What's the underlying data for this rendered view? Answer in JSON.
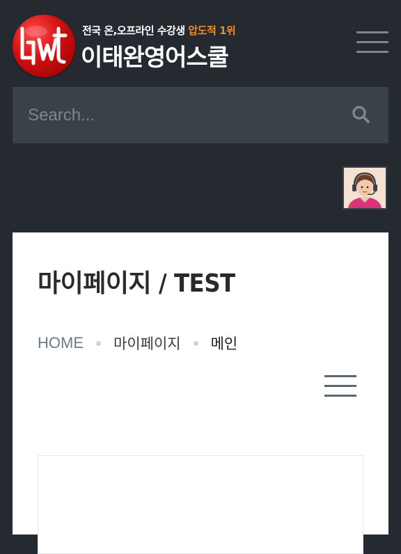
{
  "header": {
    "tagline_prefix": "전국 온,오프라인 수강생 ",
    "tagline_accent": "압도적 1위",
    "brand_name": "이태완영어스쿨",
    "accent_color": "#f08a24",
    "logo_color": "#d10f0f"
  },
  "search": {
    "placeholder": "Search..."
  },
  "page": {
    "title": "마이페이지 / TEST"
  },
  "breadcrumb": {
    "home": "HOME",
    "mid": "마이페이지",
    "current": "메인"
  },
  "icons": {
    "menu": "hamburger-icon",
    "search": "search-icon",
    "avatar": "support-agent-icon"
  }
}
